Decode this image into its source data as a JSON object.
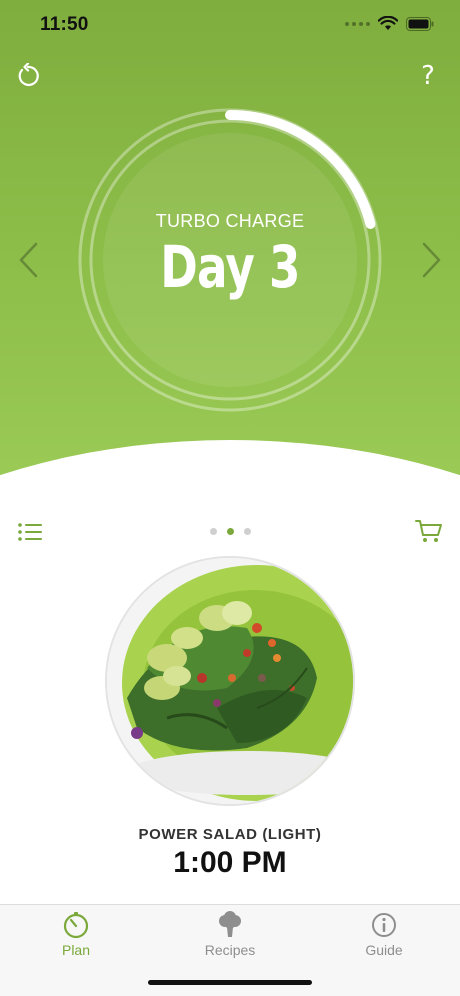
{
  "status_bar": {
    "time": "11:50"
  },
  "header": {
    "phase": "TURBO CHARGE",
    "day": "Day 3",
    "progress": 0.21,
    "help_label": "?"
  },
  "pager": {
    "pages": 3,
    "active_index": 1
  },
  "meal": {
    "name": "POWER SALAD (LIGHT)",
    "time": "1:00 PM"
  },
  "tabs": [
    {
      "label": "Plan",
      "icon": "timer-icon",
      "active": true
    },
    {
      "label": "Recipes",
      "icon": "broccoli-icon",
      "active": false
    },
    {
      "label": "Guide",
      "icon": "info-icon",
      "active": false
    }
  ],
  "colors": {
    "brand_green": "#8ebf4a",
    "accent_green": "#7aa83a",
    "tab_inactive": "#8e8e8e"
  }
}
